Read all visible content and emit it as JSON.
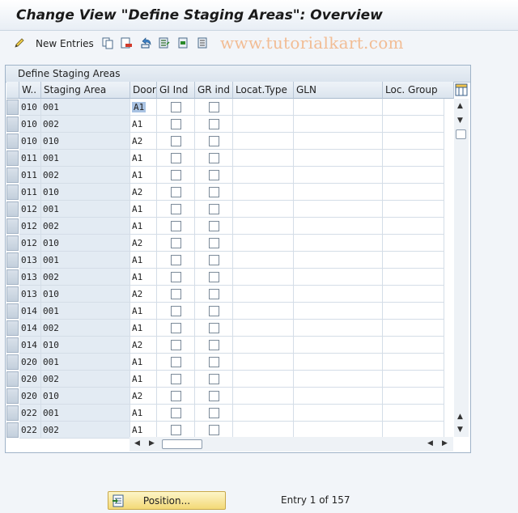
{
  "window": {
    "title": "Change View \"Define Staging Areas\": Overview"
  },
  "toolbar": {
    "new_entries_label": "New Entries",
    "icons": [
      "edit-pencil-icon",
      "copy-icon",
      "delete-icon",
      "undo-icon",
      "select-all-icon",
      "select-block-icon",
      "deselect-all-icon"
    ]
  },
  "watermark": "www.tutorialkart.com",
  "table": {
    "title": "Define Staging Areas",
    "columns": [
      "W..",
      "Staging Area",
      "Door",
      "GI Ind",
      "GR ind",
      "Locat.Type",
      "GLN",
      "Loc. Group"
    ],
    "rows": [
      {
        "w": "010",
        "area": "001",
        "door": "A1",
        "gi": false,
        "gr": false
      },
      {
        "w": "010",
        "area": "002",
        "door": "A1",
        "gi": false,
        "gr": false
      },
      {
        "w": "010",
        "area": "010",
        "door": "A2",
        "gi": false,
        "gr": false
      },
      {
        "w": "011",
        "area": "001",
        "door": "A1",
        "gi": false,
        "gr": false
      },
      {
        "w": "011",
        "area": "002",
        "door": "A1",
        "gi": false,
        "gr": false
      },
      {
        "w": "011",
        "area": "010",
        "door": "A2",
        "gi": false,
        "gr": false
      },
      {
        "w": "012",
        "area": "001",
        "door": "A1",
        "gi": false,
        "gr": false
      },
      {
        "w": "012",
        "area": "002",
        "door": "A1",
        "gi": false,
        "gr": false
      },
      {
        "w": "012",
        "area": "010",
        "door": "A2",
        "gi": false,
        "gr": false
      },
      {
        "w": "013",
        "area": "001",
        "door": "A1",
        "gi": false,
        "gr": false
      },
      {
        "w": "013",
        "area": "002",
        "door": "A1",
        "gi": false,
        "gr": false
      },
      {
        "w": "013",
        "area": "010",
        "door": "A2",
        "gi": false,
        "gr": false
      },
      {
        "w": "014",
        "area": "001",
        "door": "A1",
        "gi": false,
        "gr": false
      },
      {
        "w": "014",
        "area": "002",
        "door": "A1",
        "gi": false,
        "gr": false
      },
      {
        "w": "014",
        "area": "010",
        "door": "A2",
        "gi": false,
        "gr": false
      },
      {
        "w": "020",
        "area": "001",
        "door": "A1",
        "gi": false,
        "gr": false
      },
      {
        "w": "020",
        "area": "002",
        "door": "A1",
        "gi": false,
        "gr": false
      },
      {
        "w": "020",
        "area": "010",
        "door": "A2",
        "gi": false,
        "gr": false
      },
      {
        "w": "022",
        "area": "001",
        "door": "A1",
        "gi": false,
        "gr": false
      },
      {
        "w": "022",
        "area": "002",
        "door": "A1",
        "gi": false,
        "gr": false
      }
    ]
  },
  "footer": {
    "position_label": "Position...",
    "entry_text": "Entry 1 of 157"
  }
}
